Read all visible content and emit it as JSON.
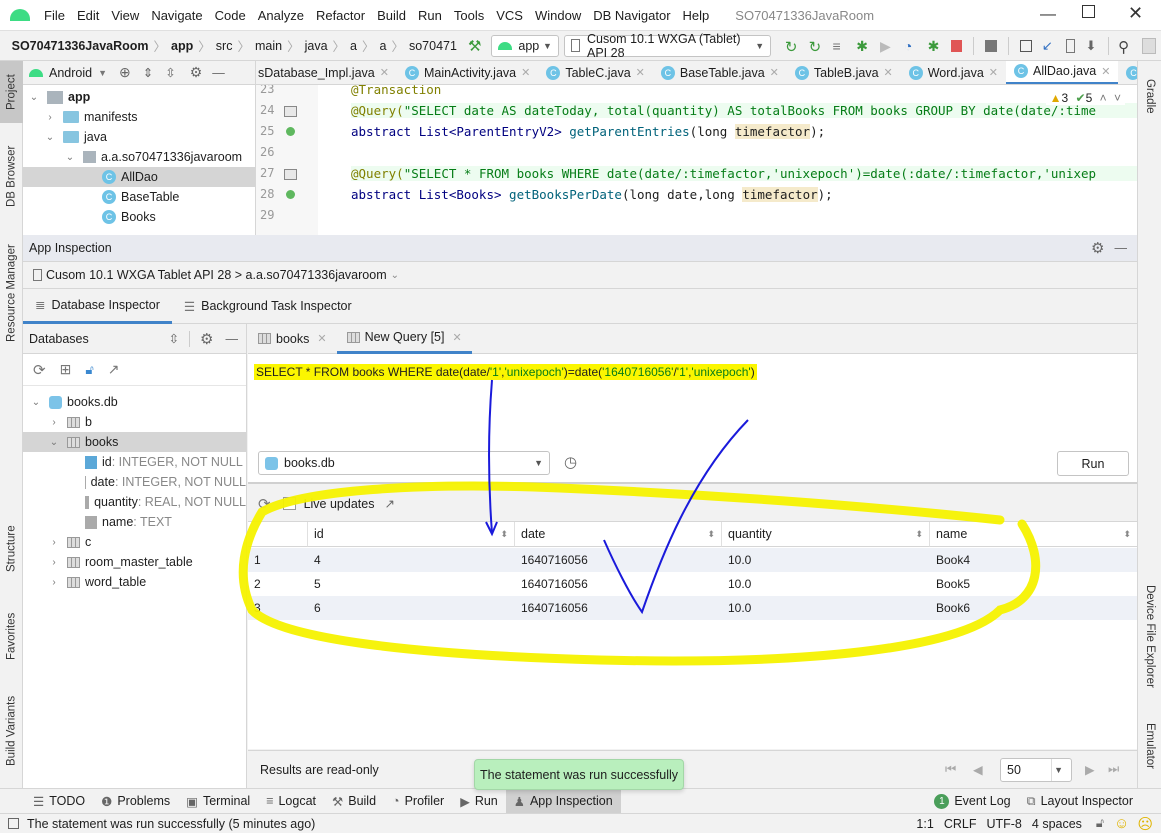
{
  "menubar": {
    "items": [
      "File",
      "Edit",
      "View",
      "Navigate",
      "Code",
      "Analyze",
      "Refactor",
      "Build",
      "Run",
      "Tools",
      "VCS",
      "Window",
      "DB Navigator",
      "Help"
    ],
    "window_title": "SO70471336JavaRoom"
  },
  "navbar": {
    "breadcrumbs": [
      "SO70471336JavaRoom",
      "app",
      "src",
      "main",
      "java",
      "a",
      "a",
      "so70471"
    ],
    "run_config": "app",
    "device": "Cusom 10.1  WXGA (Tablet)  API 28"
  },
  "left_stripe": [
    "Project",
    "DB Browser",
    "Resource Manager",
    "Structure",
    "Favorites",
    "Build Variants"
  ],
  "right_stripe": [
    "Gradle",
    "Device File Explorer",
    "Emulator"
  ],
  "project": {
    "view_label": "Android",
    "tree": [
      {
        "label": "app",
        "level": 0,
        "arrow": "v",
        "icon": "module"
      },
      {
        "label": "manifests",
        "level": 1,
        "arrow": ">",
        "icon": "folder"
      },
      {
        "label": "java",
        "level": 1,
        "arrow": "v",
        "icon": "folder"
      },
      {
        "label": "a.a.so70471336javaroom",
        "level": 2,
        "arrow": "v",
        "icon": "package"
      },
      {
        "label": "AllDao",
        "level": 3,
        "icon": "class",
        "selected": true
      },
      {
        "label": "BaseTable",
        "level": 3,
        "icon": "class"
      },
      {
        "label": "Books",
        "level": 3,
        "icon": "class"
      }
    ]
  },
  "editor_tabs": [
    {
      "label": "sDatabase_Impl.java"
    },
    {
      "label": "MainActivity.java"
    },
    {
      "label": "TableC.java"
    },
    {
      "label": "BaseTable.java"
    },
    {
      "label": "TableB.java"
    },
    {
      "label": "Word.java"
    },
    {
      "label": "AllDao.java",
      "active": true
    }
  ],
  "editor": {
    "inspections": {
      "warnings": "3",
      "ok": "5"
    },
    "line_numbers": [
      "23",
      "24",
      "25",
      "26",
      "27",
      "28",
      "29"
    ],
    "lines": {
      "l23": "@Transaction",
      "l24_ann": "@Query(",
      "l24_str": "\"SELECT date AS dateToday, total(quantity) AS totalBooks FROM books GROUP BY date(date/:time",
      "l25_a": "abstract List<ParentEntryV2> ",
      "l25_fn": "getParentEntries",
      "l25_b": "(long ",
      "l25_p": "timefactor",
      "l25_c": ");",
      "l27_ann": "@Query(",
      "l27_str": "\"SELECT * FROM books WHERE date(date/:timefactor,'unixepoch')=date(:date/:timefactor,'unixep",
      "l28_a": "abstract List<Books> ",
      "l28_fn": "getBooksPerDate",
      "l28_b": "(long date,long ",
      "l28_p": "timefactor",
      "l28_c": ");"
    }
  },
  "app_inspection": {
    "title": "App Inspection",
    "device_process": "Cusom 10.1 WXGA Tablet API 28 > a.a.so70471336javaroom",
    "tabs": [
      "Database Inspector",
      "Background Task Inspector"
    ],
    "databases_label": "Databases",
    "db_tree": [
      {
        "label": "books.db",
        "level": 0,
        "arrow": "v",
        "icon": "database"
      },
      {
        "label": "b",
        "level": 1,
        "arrow": ">",
        "icon": "table"
      },
      {
        "label": "books",
        "level": 1,
        "arrow": "v",
        "icon": "table",
        "selected": true
      },
      {
        "label": "id",
        "type": " :  INTEGER, NOT NULL",
        "level": 2,
        "icon": "key-column"
      },
      {
        "label": "date",
        "type": " :  INTEGER, NOT NULL",
        "level": 2,
        "icon": "column"
      },
      {
        "label": "quantity",
        "type": " :  REAL, NOT NULL",
        "level": 2,
        "icon": "column"
      },
      {
        "label": "name",
        "type": " :  TEXT",
        "level": 2,
        "icon": "column"
      },
      {
        "label": "c",
        "level": 1,
        "arrow": ">",
        "icon": "table"
      },
      {
        "label": "room_master_table",
        "level": 1,
        "arrow": ">",
        "icon": "table"
      },
      {
        "label": "word_table",
        "level": 1,
        "arrow": ">",
        "icon": "table"
      }
    ],
    "query_tabs": [
      {
        "label": "books"
      },
      {
        "label": "New Query [5]",
        "active": true
      }
    ],
    "query": {
      "p1": "SELECT * FROM books WHERE date(date/",
      "s1": "'1'",
      "p2": ",",
      "s2": "'unixepoch'",
      "p3": ")=date(",
      "s3": "'1640716056'",
      "p4": "/",
      "s4": "'1'",
      "p5": ",",
      "s5": "'unixepoch'",
      "p6": ")"
    },
    "db_select": "books.db",
    "run_label": "Run",
    "live_updates_label": "Live updates",
    "live_updates_checked": false,
    "columns": [
      "id",
      "date",
      "quantity",
      "name"
    ],
    "rows": [
      {
        "n": "1",
        "id": "4",
        "date": "1640716056",
        "quantity": "10.0",
        "name": "Book4"
      },
      {
        "n": "2",
        "id": "5",
        "date": "1640716056",
        "quantity": "10.0",
        "name": "Book5"
      },
      {
        "n": "3",
        "id": "6",
        "date": "1640716056",
        "quantity": "10.0",
        "name": "Book6"
      }
    ],
    "readonly_label": "Results are read-only",
    "page_size": "50"
  },
  "toast": "The statement was run successfully",
  "bottom_tools": [
    "TODO",
    "Problems",
    "Terminal",
    "Logcat",
    "Build",
    "Profiler",
    "Run",
    "App Inspection"
  ],
  "bottom_tools_active": "App Inspection",
  "bottom_right_tools": {
    "event_log_count": "1",
    "event_log": "Event Log",
    "layout_inspector": "Layout Inspector"
  },
  "status": {
    "message": "The statement was run successfully (5 minutes ago)",
    "position": "1:1",
    "line_sep": "CRLF",
    "encoding": "UTF-8",
    "indent": "4 spaces"
  },
  "colors": {
    "accent": "#4083c9",
    "highlight": "#fbf600",
    "pen": "#1a1adb",
    "toast_bg": "#b9efbd"
  }
}
